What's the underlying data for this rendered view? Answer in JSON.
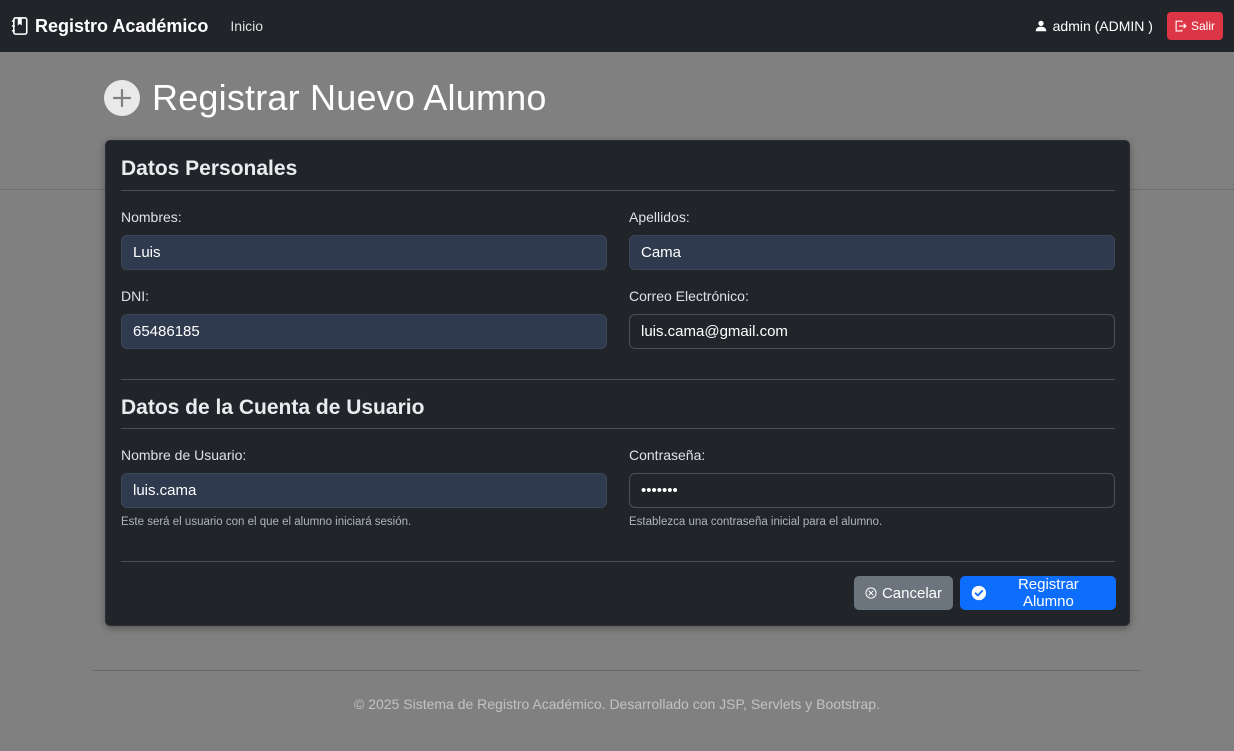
{
  "navbar": {
    "brand": "Registro Académico",
    "home_link": "Inicio",
    "user_label": "admin (ADMIN )",
    "logout_label": "Salir"
  },
  "page": {
    "title": "Registrar Nuevo Alumno"
  },
  "personal": {
    "section_title": "Datos Personales",
    "nombres_label": "Nombres:",
    "nombres_value": "Luis",
    "apellidos_label": "Apellidos:",
    "apellidos_value": "Cama",
    "dni_label": "DNI:",
    "dni_value": "65486185",
    "email_label": "Correo Electrónico:",
    "email_value": "luis.cama@gmail.com"
  },
  "account": {
    "section_title": "Datos de la Cuenta de Usuario",
    "username_label": "Nombre de Usuario:",
    "username_value": "luis.cama",
    "username_help": "Este será el usuario con el que el alumno iniciará sesión.",
    "password_label": "Contraseña:",
    "password_value": "1234567",
    "password_help": "Establezca una contraseña inicial para el alumno."
  },
  "actions": {
    "cancel_label": "Cancelar",
    "submit_label": "Registrar Alumno"
  },
  "footer": {
    "text": "© 2025 Sistema de Registro Académico. Desarrollado con JSP, Servlets y Bootstrap."
  },
  "colors": {
    "navbar_bg": "#212529",
    "card_bg": "#212529",
    "danger": "#dc3545",
    "primary": "#0d6efd",
    "secondary": "#6c757d",
    "overlay_bg": "#808080"
  },
  "icons": {
    "brand": "journal-bookmark-icon",
    "user": "person-icon",
    "logout": "box-arrow-right-icon",
    "title": "plus-circle-icon",
    "cancel": "x-circle-icon",
    "submit": "check-circle-icon"
  }
}
